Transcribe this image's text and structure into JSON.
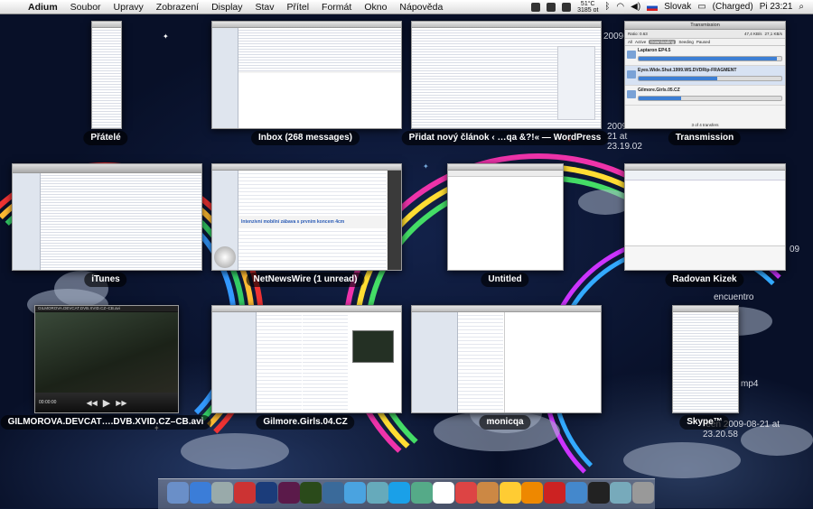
{
  "menubar": {
    "apple_icon": "apple-logo-icon",
    "app_name": "Adium",
    "menus": [
      "Soubor",
      "Upravy",
      "Zobrazení",
      "Display",
      "Stav",
      "Přítel",
      "Formát",
      "Okno",
      "Nápověda"
    ],
    "weather": "51°C",
    "weather_sub": "3185 ot",
    "input_language": "Slovak",
    "battery": "(Charged)",
    "clock": "Pi 23:21"
  },
  "windows": [
    {
      "label": "Přátelé"
    },
    {
      "label": "Inbox (268 messages)"
    },
    {
      "label": "Přidat nový článok ‹ …qa &?!« — WordPress"
    },
    {
      "label": "Transmission"
    },
    {
      "label": "iTunes"
    },
    {
      "label": "NetNewsWire (1 unread)"
    },
    {
      "label": "Untitled"
    },
    {
      "label": "Radovan Kizek"
    },
    {
      "label": "GILMOROVA.DEVCAT….DVB.XVID.CZ–CB.avi"
    },
    {
      "label": "Gilmore.Girls.04.CZ"
    },
    {
      "label": "monicqa"
    },
    {
      "label": "Skype™"
    }
  ],
  "transmission": {
    "title": "Transmission",
    "ratio": "Ratio: 0.63",
    "filters": [
      "All",
      "Active",
      "Downloading",
      "Seeding",
      "Paused"
    ],
    "speed_down": "47,4 KB/s",
    "speed_up": "27,1 KB/s",
    "torrents": [
      {
        "name": "Laptaron EP4.5",
        "progress": 0.97
      },
      {
        "name": "Eyes.Wide.Shut.1999.WS.DVDRip-FRAGMENT",
        "progress": 0.55
      },
      {
        "name": "Gilmore.Girls.05.CZ",
        "progress": 0.3
      }
    ],
    "footer": "3 of 4 transfers"
  },
  "netnewswire_headline": "Intenzivní mobilní zábava s prvním koncem 4cm",
  "video_title": "GILMOROVA.DEVCAT.DVB.XVID.CZ–CB.avi",
  "video_time": "00:00:00",
  "desktop_files": [
    {
      "text": "2009-08-21 (2)"
    },
    {
      "text": "2009-08-21 at 23.19.02"
    },
    {
      "text": "09"
    },
    {
      "text": "encuentro"
    },
    {
      "text": "mp4"
    },
    {
      "text": "reen 2009-08-21 at 23.20.58"
    }
  ],
  "dock_icons": [
    "finder-icon",
    "safari-icon",
    "preview-icon",
    "ical-icon",
    "photoshop-icon",
    "indesign-icon",
    "dreamweaver-icon",
    "xcode-icon",
    "itunes-icon",
    "iphoto-icon",
    "skype-icon",
    "adium-icon",
    "miffy-icon",
    "calendar-icon",
    "photo-icon",
    "duck-icon",
    "vlc-icon",
    "transmission-icon",
    "safari-2-icon",
    "terminal-icon",
    "folder-icon",
    "trash-icon"
  ]
}
